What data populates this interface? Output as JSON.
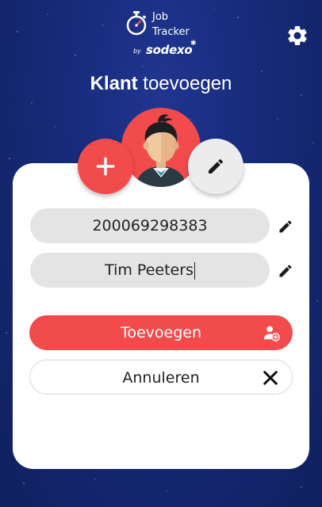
{
  "app": {
    "logo_line1": "Job",
    "logo_line2": "Tracker",
    "logo_by": "by",
    "logo_brand": "sodexo"
  },
  "header": {
    "title_bold": "Klant",
    "title_rest": "toevoegen"
  },
  "form": {
    "customer_id_value": "200069298383",
    "customer_name_value": "Tim Peeters"
  },
  "actions": {
    "add_label": "Toevoegen",
    "cancel_label": "Annuleren"
  },
  "icons": {
    "settings": "gear-icon",
    "stopwatch": "stopwatch-icon",
    "add_photo": "plus-icon",
    "edit_photo": "pencil-icon",
    "edit_field": "pencil-icon",
    "add_user": "add-user-icon",
    "cancel": "close-icon"
  },
  "colors": {
    "accent": "#f24b4b",
    "background": "#172a78",
    "field": "#e4e4e4"
  }
}
